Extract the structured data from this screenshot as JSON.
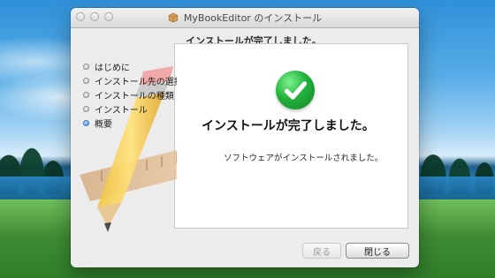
{
  "window": {
    "title": "MyBookEditor のインストール",
    "header": "インストールが完了しました。"
  },
  "sidebar": {
    "steps": [
      {
        "label": "はじめに",
        "active": false
      },
      {
        "label": "インストール先の選択",
        "active": false
      },
      {
        "label": "インストールの種類",
        "active": false
      },
      {
        "label": "インストール",
        "active": false
      },
      {
        "label": "概要",
        "active": true
      }
    ]
  },
  "main": {
    "headline": "インストールが完了しました。",
    "subtext": "ソフトウェアがインストールされました。"
  },
  "footer": {
    "back_label": "戻る",
    "close_label": "閉じる"
  },
  "icons": {
    "title_icon": "package-icon",
    "status_icon": "checkmark-icon"
  },
  "colors": {
    "success_green": "#22b23c",
    "active_step_blue": "#3b7fe0"
  }
}
